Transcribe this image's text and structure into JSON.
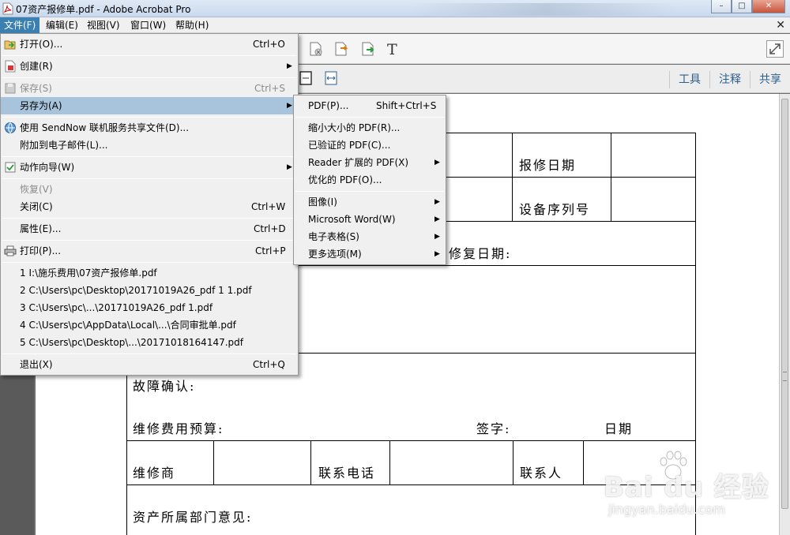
{
  "window": {
    "title": "07资产报修单.pdf - Adobe Acrobat Pro",
    "buttons": {
      "minimize": "–",
      "maximize": "□",
      "close": "✕"
    }
  },
  "menubar": {
    "items": [
      "文件(F)",
      "编辑(E)",
      "视图(V)",
      "窗口(W)",
      "帮助(H)"
    ],
    "active_index": 0
  },
  "toolbar": {
    "tabs": [
      "工具",
      "注释",
      "共享"
    ],
    "icons": [
      "delete-page-icon",
      "export-icon",
      "insert-pages-icon",
      "text-edit-icon",
      "fit-page-icon",
      "fit-width-icon",
      "expand-icon"
    ],
    "text_tool_glyph": "T"
  },
  "file_menu": {
    "items": [
      {
        "label": "打开(O)...",
        "shortcut": "Ctrl+O",
        "icon": "open-folder-icon"
      },
      {
        "label": "创建(R)",
        "submenu": true,
        "icon": "create-pdf-icon"
      },
      {
        "label": "保存(S)",
        "shortcut": "Ctrl+S",
        "disabled": true,
        "icon": "save-icon"
      },
      {
        "label": "另存为(A)",
        "submenu": true,
        "highlighted": true
      },
      {
        "label": "使用 SendNow 联机服务共享文件(D)...",
        "icon": "globe-icon"
      },
      {
        "label": "附加到电子邮件(L)..."
      },
      {
        "label": "动作向导(W)",
        "submenu": true,
        "icon": "action-wizard-icon"
      },
      {
        "label": "恢复(V)",
        "disabled": true
      },
      {
        "label": "关闭(C)",
        "shortcut": "Ctrl+W"
      },
      {
        "label": "属性(E)...",
        "shortcut": "Ctrl+D"
      },
      {
        "label": "打印(P)...",
        "shortcut": "Ctrl+P",
        "icon": "print-icon"
      },
      {
        "label": "1 I:\\施乐费用\\07资产报修单.pdf"
      },
      {
        "label": "2 C:\\Users\\pc\\Desktop\\20171019A26_pdf 1 1.pdf"
      },
      {
        "label": "3 C:\\Users\\pc\\...\\20171019A26_pdf 1.pdf"
      },
      {
        "label": "4 C:\\Users\\pc\\AppData\\Local\\...\\合同审批单.pdf"
      },
      {
        "label": "5 C:\\Users\\pc\\Desktop\\...\\20171018164147.pdf"
      },
      {
        "label": "退出(X)",
        "shortcut": "Ctrl+Q"
      }
    ]
  },
  "save_as_menu": {
    "items": [
      {
        "label": "PDF(P)...",
        "shortcut": "Shift+Ctrl+S"
      },
      {
        "label": "缩小大小的 PDF(R)..."
      },
      {
        "label": "已验证的 PDF(C)..."
      },
      {
        "label": "Reader 扩展的 PDF(X)",
        "submenu": true
      },
      {
        "label": "优化的 PDF(O)..."
      },
      {
        "label": "图像(I)",
        "submenu": true
      },
      {
        "label": "Microsoft Word(W)",
        "submenu": true
      },
      {
        "label": "电子表格(S)",
        "submenu": true
      },
      {
        "label": "更多选项(M)",
        "submenu": true
      }
    ]
  },
  "document": {
    "labels": {
      "repair_date": "报修日期",
      "device_serial": "设备序列号",
      "fix_date": "修复日期:",
      "fault_confirm": "故障确认:",
      "budget": "维修费用预算:",
      "signature": "签字:",
      "date": "日期",
      "vendor": "维修商",
      "phone": "联系电话",
      "contact": "联系人",
      "dept_opinion": "资产所属部门意见:"
    }
  },
  "watermark": {
    "logo": "Bai du 经验",
    "url": "jingyan.baidu.com"
  }
}
